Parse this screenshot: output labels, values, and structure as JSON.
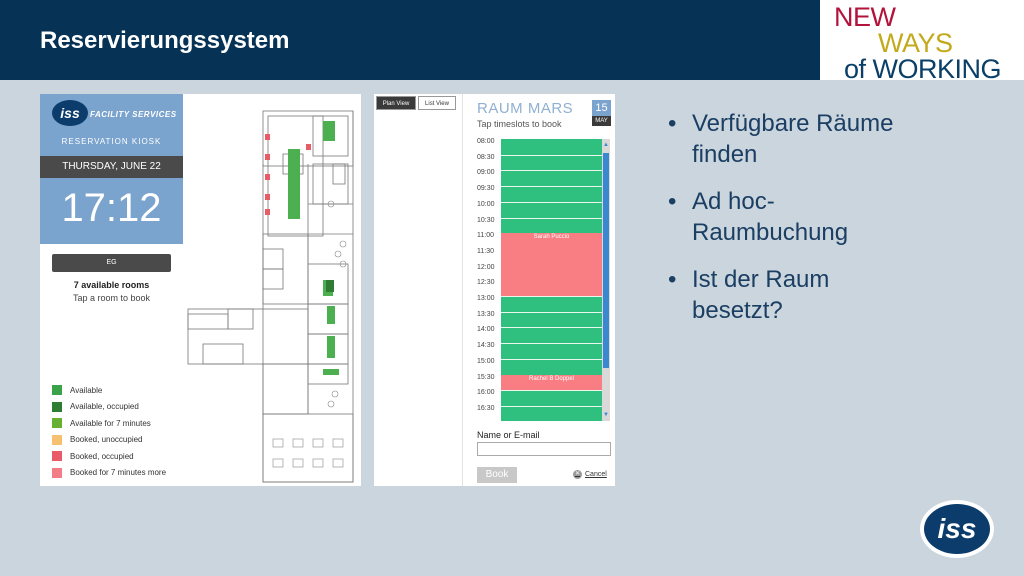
{
  "header": {
    "title": "Reservierungssystem"
  },
  "brand": {
    "line1": "NEW",
    "line2": "WAYS",
    "line3": "of WORKING"
  },
  "kiosk": {
    "logo_text": "iss",
    "subtitle": "FACILITY SERVICES",
    "label": "RESERVATION KIOSK",
    "date": "THURSDAY, JUNE 22",
    "time": "17:12",
    "floor_button": "EG",
    "available_rooms": "7 available rooms",
    "tap_hint": "Tap a room to book",
    "legend": [
      {
        "label": "Available",
        "color": "#3aa34a"
      },
      {
        "label": "Available, occupied",
        "color": "#2e7d32"
      },
      {
        "label": "Available for 7 minutes",
        "color": "#66b032"
      },
      {
        "label": "Booked, unoccupied",
        "color": "#f6c16e"
      },
      {
        "label": "Booked, occupied",
        "color": "#e85b67"
      },
      {
        "label": "Booked for 7 minutes more",
        "color": "#f27d86"
      }
    ]
  },
  "booking": {
    "plan_view": "Plan View",
    "list_view": "List View",
    "room_name": "RAUM MARS",
    "hint": "Tap timeslots to book",
    "date_day": "15",
    "date_month": "MAY",
    "times": [
      "08:00",
      "08:30",
      "09:00",
      "09:30",
      "10:00",
      "10:30",
      "11:00",
      "11:30",
      "12:00",
      "12:30",
      "13:00",
      "13:30",
      "14:00",
      "14:30",
      "15:00",
      "15:30",
      "16:00",
      "16:30"
    ],
    "bookings": [
      {
        "name": "Sarah Puccio",
        "start": 6,
        "end": 10
      },
      {
        "name": "Rachel B Doppel",
        "start": 15,
        "end": 16
      }
    ],
    "name_label": "Name or E-mail",
    "name_value": "",
    "book_button": "Book",
    "cancel": "Cancel"
  },
  "bullets": [
    "Verfügbare Räume finden",
    "Ad hoc-Raumbuchung",
    "Ist der Raum besetzt?"
  ],
  "footer_logo": "iss"
}
